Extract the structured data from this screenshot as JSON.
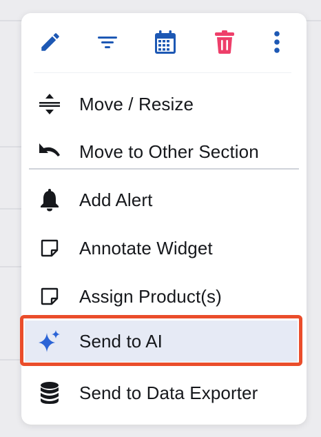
{
  "toolbar": {
    "icons": [
      {
        "name": "pencil-icon",
        "color": "#1d58b4"
      },
      {
        "name": "filter-icon",
        "color": "#1d58b4"
      },
      {
        "name": "calendar-icon",
        "color": "#1d58b4"
      },
      {
        "name": "trash-icon",
        "color": "#ee3f6a"
      },
      {
        "name": "more-vertical-icon",
        "color": "#1d58b4"
      }
    ]
  },
  "menu": {
    "items": [
      {
        "label": "Move / Resize",
        "icon": "move-resize-icon"
      },
      {
        "label": "Move to Other Section",
        "icon": "undo-arrow-icon"
      },
      {
        "label": "Add Alert",
        "icon": "bell-icon"
      },
      {
        "label": "Annotate Widget",
        "icon": "sticky-note-icon"
      },
      {
        "label": "Assign Product(s)",
        "icon": "sticky-note-icon"
      },
      {
        "label": "Send to AI",
        "icon": "sparkle-icon",
        "highlighted": true,
        "icon_color": "#2c64d6"
      },
      {
        "label": "Send to Data Exporter",
        "icon": "database-icon"
      }
    ]
  },
  "colors": {
    "accent_blue": "#1d58b4",
    "danger_pink": "#ee3f6a",
    "highlight_bg": "#e6eaf5",
    "focus_outline": "#ea4d2b"
  }
}
